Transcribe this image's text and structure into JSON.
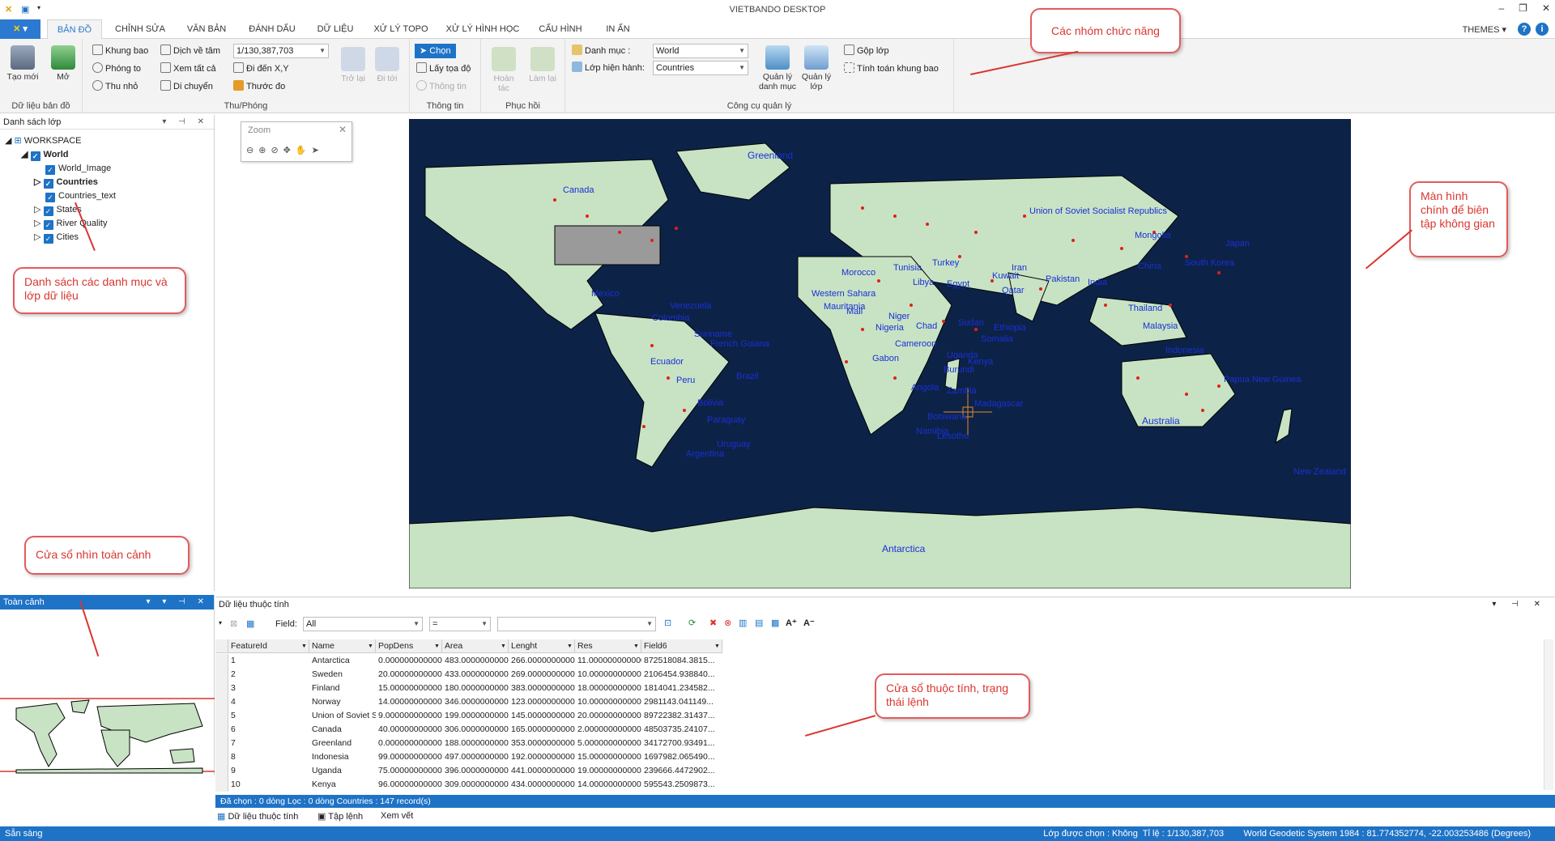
{
  "app": {
    "title": "VIETBANDO DESKTOP",
    "themes_label": "THEMES"
  },
  "tabs": {
    "file_label": "",
    "items": [
      "BẢN ĐỒ",
      "CHỈNH SỬA",
      "VĂN BẢN",
      "ĐÁNH DẤU",
      "DỮ LIỆU",
      "XỬ LÝ TOPO",
      "XỬ LÝ HÌNH HỌC",
      "CẤU HÌNH",
      "IN ẤN"
    ]
  },
  "ribbon": {
    "data_group": {
      "label": "Dữ liệu bản đồ",
      "new": "Tạo mới",
      "open": "Mở"
    },
    "zoom_group": {
      "label": "Thu/Phóng",
      "zoom_box": "Khung bao",
      "zoom_in": "Phóng to",
      "zoom_out": "Thu nhỏ",
      "pan_center": "Dịch về tâm",
      "full_extent": "Xem tất cả",
      "move": "Di chuyển",
      "scale": "1/130,387,703",
      "goto_xy": "Đi đến X,Y",
      "measure": "Thước đo",
      "back": "Trở lại",
      "forward": "Đi tới"
    },
    "info_group": {
      "label": "Thông tin",
      "select": "Chọn",
      "get_coord": "Lấy tọa độ",
      "info": "Thông tin"
    },
    "undo_group": {
      "label": "Phục hồi",
      "undo": "Hoàn tác",
      "redo": "Làm lại"
    },
    "manage_group": {
      "label": "Công cụ quản lý",
      "catalog_label": "Danh mục :",
      "catalog_value": "World",
      "layer_label": "Lớp hiện hành:",
      "layer_value": "Countries",
      "manage_catalog": "Quản lý danh mục",
      "manage_layer": "Quản lý lớp",
      "merge_layer": "Gộp lớp",
      "calc_extent": "Tính toán khung bao"
    }
  },
  "layer_panel": {
    "title": "Danh sách lớp",
    "workspace": "WORKSPACE",
    "root": "World",
    "layers": [
      "World_Image",
      "Countries",
      "Countries_text",
      "States",
      "River Quality",
      "Cities"
    ]
  },
  "overview_panel": {
    "title": "Toàn cảnh"
  },
  "zoom_panel": {
    "title": "Zoom"
  },
  "map_labels": [
    "Greenland",
    "Canada",
    "Union of Soviet Socialist Republics",
    "Mongolia",
    "China",
    "Libya",
    "Egypt",
    "Brazil",
    "Peru",
    "Bolivia",
    "Paraguay",
    "Argentina",
    "Australia",
    "Antarctica",
    "Angola",
    "Botswana",
    "Mexico",
    "Western Sahara",
    "Niger",
    "Chad",
    "Sudan",
    "Pakistan",
    "India",
    "Kenya",
    "Somalia",
    "Madagascar",
    "Namibia",
    "Papua New Guinea",
    "New Zealand",
    "Uruguay",
    "Colombia",
    "Venezuela",
    "Qatar",
    "Kuwait",
    "Iran",
    "Turkey",
    "Tunisia",
    "Morocco",
    "Mali",
    "Ethiopia",
    "Uganda",
    "Burundi",
    "Zambia",
    "Lesotho",
    "Japan",
    "South Korea",
    "Thailand",
    "Indonesia",
    "Malaysia",
    "Mauritania",
    "Cameroon",
    "Gabon",
    "Ecuador",
    "French Guiana",
    "Suriname",
    "Nigeria"
  ],
  "attr_panel": {
    "title": "Dữ liệu thuộc tính",
    "field_label": "Field:",
    "field_value": "All",
    "op_value": "=",
    "columns": [
      "FeatureId",
      "Name",
      "PopDens",
      "Area",
      "Lenght",
      "Res",
      "Field6"
    ],
    "rows": [
      [
        "1",
        "Antarctica",
        "0.000000000000",
        "483.000000000000",
        "266.000000000000",
        "11.000000000000",
        "872518084.3815..."
      ],
      [
        "2",
        "Sweden",
        "20.000000000000",
        "433.000000000000",
        "269.000000000000",
        "10.000000000000",
        "2106454.938840..."
      ],
      [
        "3",
        "Finland",
        "15.000000000000",
        "180.000000000000",
        "383.000000000000",
        "18.000000000000",
        "1814041.234582..."
      ],
      [
        "4",
        "Norway",
        "14.000000000000",
        "346.000000000000",
        "123.000000000000",
        "10.000000000000",
        "2981143.041149..."
      ],
      [
        "5",
        "Union of Soviet S...",
        "9.000000000000",
        "199.000000000000",
        "145.000000000000",
        "20.000000000000",
        "89722382.31437..."
      ],
      [
        "6",
        "Canada",
        "40.000000000000",
        "306.000000000000",
        "165.000000000000",
        "2.000000000000",
        "48503735.24107..."
      ],
      [
        "7",
        "Greenland",
        "0.000000000000",
        "188.000000000000",
        "353.000000000000",
        "5.000000000000",
        "34172700.93491..."
      ],
      [
        "8",
        "Indonesia",
        "99.000000000000",
        "497.000000000000",
        "192.000000000000",
        "15.000000000000",
        "1697982.065490..."
      ],
      [
        "9",
        "Uganda",
        "75.000000000000",
        "396.000000000000",
        "441.000000000000",
        "19.000000000000",
        "239666.4472902..."
      ],
      [
        "10",
        "Kenya",
        "96.000000000000",
        "309.000000000000",
        "434.000000000000",
        "14.000000000000",
        "595543.2509873..."
      ]
    ],
    "status": "Đã chọn : 0 dòng    Lọc : 0 dòng    Countries : 147 record(s)",
    "bottom_tabs": [
      "Dữ liệu thuộc tính",
      "Tập lệnh",
      "Xem vết"
    ]
  },
  "statusbar": {
    "left": "Sẵn sàng",
    "right": "Lớp được chọn : Không  Tỉ lệ : 1/130,387,703        World Geodetic System 1984 : 81.774352774, -22.003253486 (Degrees)"
  },
  "callouts": {
    "ribbon": "Các nhóm chức năng",
    "map": "Màn hình chính để biên tập không gian",
    "layers": "Danh sách các danh mục và lớp dữ liệu",
    "overview": "Cửa sổ nhìn toàn cảnh",
    "attributes": "Cửa sổ thuộc tính, trạng thái lệnh"
  },
  "colors": {
    "accent": "#1e73c6",
    "callout": "#d9362f",
    "land": "#c8e3c4",
    "ocean": "#0a1e3d",
    "city": "#e0201a",
    "label": "#1a2fd6"
  }
}
